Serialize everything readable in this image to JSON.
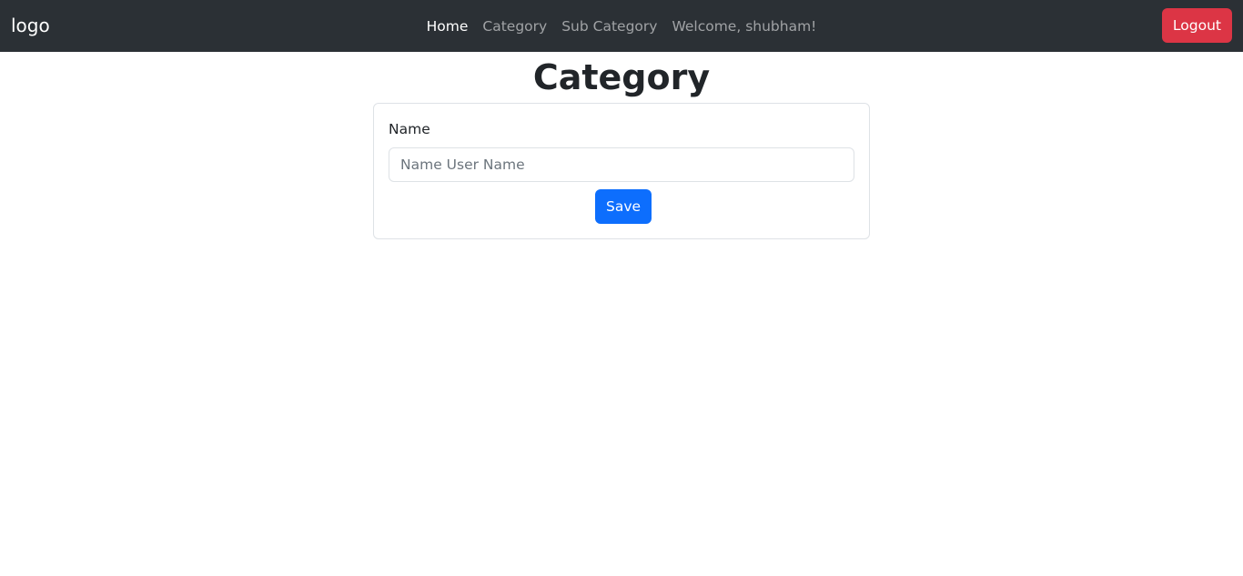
{
  "navbar": {
    "brand": "logo",
    "links": [
      {
        "label": "Home",
        "active": true
      },
      {
        "label": "Category",
        "active": false
      },
      {
        "label": "Sub Category",
        "active": false
      }
    ],
    "welcome_text": "Welcome, shubham!",
    "logout_label": "Logout"
  },
  "page": {
    "title": "Category"
  },
  "form": {
    "name_label": "Name",
    "name_placeholder": "Name User Name",
    "name_value": "",
    "save_label": "Save"
  },
  "colors": {
    "navbar_bg": "#2b3035",
    "logout": "#dc3545",
    "primary": "#0d6efd",
    "border": "#dee2e6"
  }
}
